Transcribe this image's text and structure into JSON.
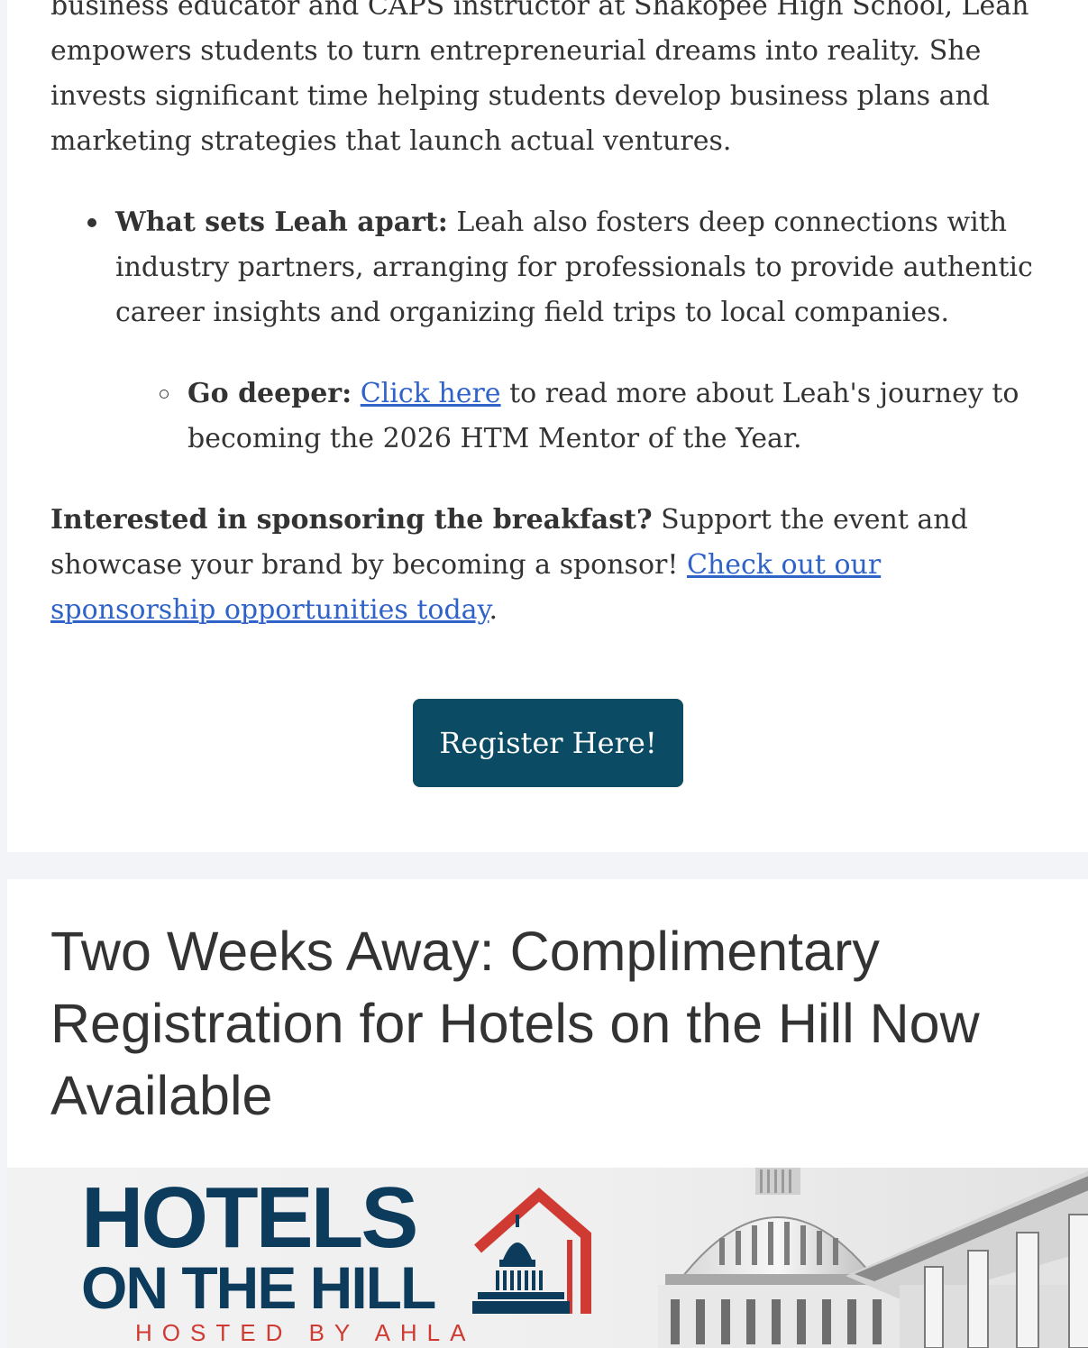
{
  "intro": {
    "text": "business educator and CAPS instructor at Shakopee High School, Leah empowers students to turn entrepreneurial dreams into reality. She invests significant time helping students develop business plans and marketing strategies that launch actual ventures."
  },
  "apart": {
    "label": "What sets Leah apart:",
    "text": " Leah also fosters deep connections with industry partners, arranging for professionals to provide authentic career insights and organizing field trips to local companies."
  },
  "deeper": {
    "label": "Go deeper:",
    "link": "Click here",
    "text": " to read more about Leah's journey to becoming the 2026 HTM Mentor of the Year."
  },
  "sponsor": {
    "label": "Interested in sponsoring the breakfast?",
    "text": " Support the event and showcase your brand by becoming a sponsor! ",
    "link": "Check out our sponsorship opportunities today",
    "end": "."
  },
  "register": {
    "label": "Register Here!"
  },
  "section": {
    "title": "Two Weeks Away: Complimentary Registration for Hotels on the Hill Now Available"
  },
  "banner": {
    "logo_line1": "HOTELS",
    "logo_line2": "ON THE HILL",
    "logo_line3": "HOSTED BY AHLA"
  },
  "colors": {
    "link": "#2f63c9",
    "button": "#0b4b64",
    "logo_navy": "#0c3b5c",
    "logo_red": "#cf3b32"
  }
}
